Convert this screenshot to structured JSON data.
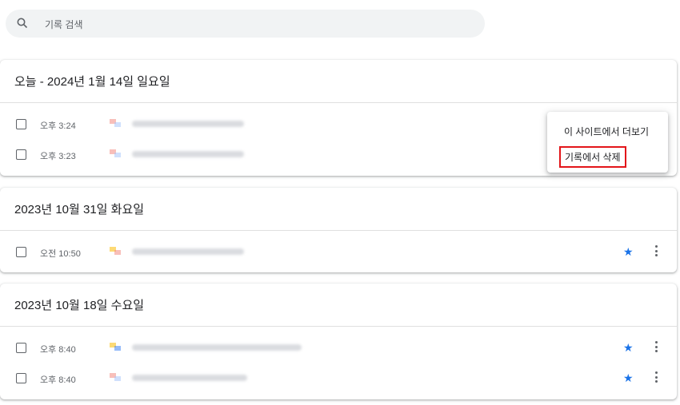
{
  "search": {
    "placeholder": "기록 검색"
  },
  "groups": [
    {
      "title": "오늘 - 2024년 1월 14일 일요일",
      "items": [
        {
          "time": "오후 3:24",
          "starred": false
        },
        {
          "time": "오후 3:23",
          "starred": false
        }
      ]
    },
    {
      "title": "2023년 10월 31일 화요일",
      "items": [
        {
          "time": "오전 10:50",
          "starred": true
        }
      ]
    },
    {
      "title": "2023년 10월 18일 수요일",
      "items": [
        {
          "time": "오후 8:40",
          "starred": true
        },
        {
          "time": "오후 8:40",
          "starred": true
        }
      ]
    }
  ],
  "context_menu": {
    "more_from_site": "이 사이트에서 더보기",
    "remove_from_history": "기록에서 삭제"
  },
  "colors": {
    "accent": "#1a73e8",
    "highlight_border": "#e3151a"
  }
}
